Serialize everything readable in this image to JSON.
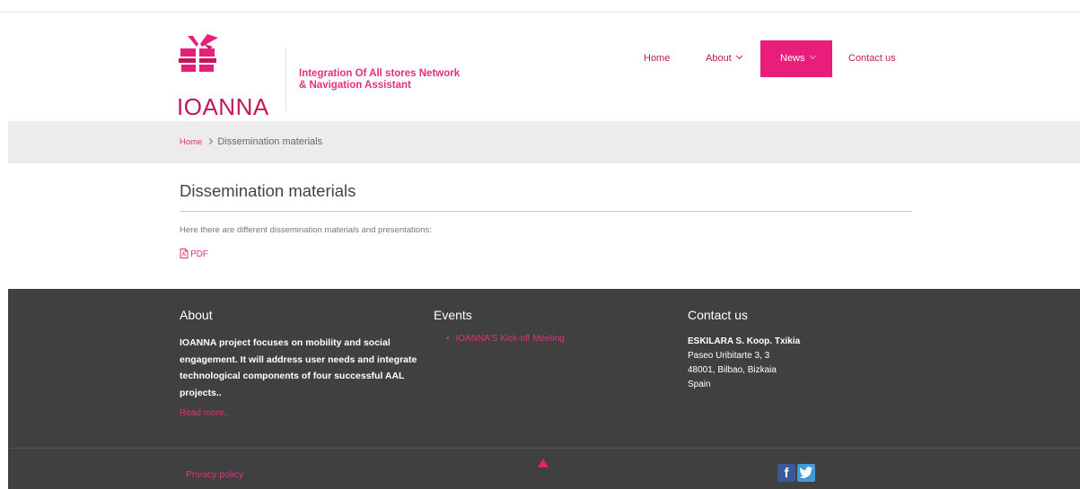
{
  "brand": {
    "logo_text": "IOANNA",
    "tagline_line1": "Integration Of All stores Network",
    "tagline_line2": "& Navigation Assistant",
    "primary_color": "#e91e7a",
    "dark_color": "#c2185b"
  },
  "nav": {
    "items": [
      {
        "label": "Home"
      },
      {
        "label": "About"
      },
      {
        "label": "News"
      },
      {
        "label": "Contact us"
      }
    ]
  },
  "breadcrumb": {
    "home": "Home",
    "current": "Dissemination materials"
  },
  "main": {
    "title": "Dissemination materials",
    "intro": "Here there are different dissemination materials and presentations:",
    "pdf_label": "PDF",
    "pdf_icon": "pdf-file-icon"
  },
  "footer": {
    "about": {
      "title": "About",
      "text": "IOANNA project focuses on mobility and social engagement. It will address user needs and integrate technological components of four successful AAL projects..",
      "read_more": "Read more.."
    },
    "events": {
      "title": "Events",
      "items": [
        "IOANNA'S Kick-off Meeting"
      ]
    },
    "contact": {
      "title": "Contact us",
      "org": "ESKILARA S. Koop. Txikia",
      "address1": "Paseo Uribitarte 3, 3",
      "address2": "48001, Bilbao, Bizkaia",
      "country": "Spain"
    },
    "privacy": "Privacy policy",
    "social": {
      "facebook": "f",
      "twitter_icon": "twitter-bird-icon"
    },
    "footer_bg": "#404040"
  }
}
